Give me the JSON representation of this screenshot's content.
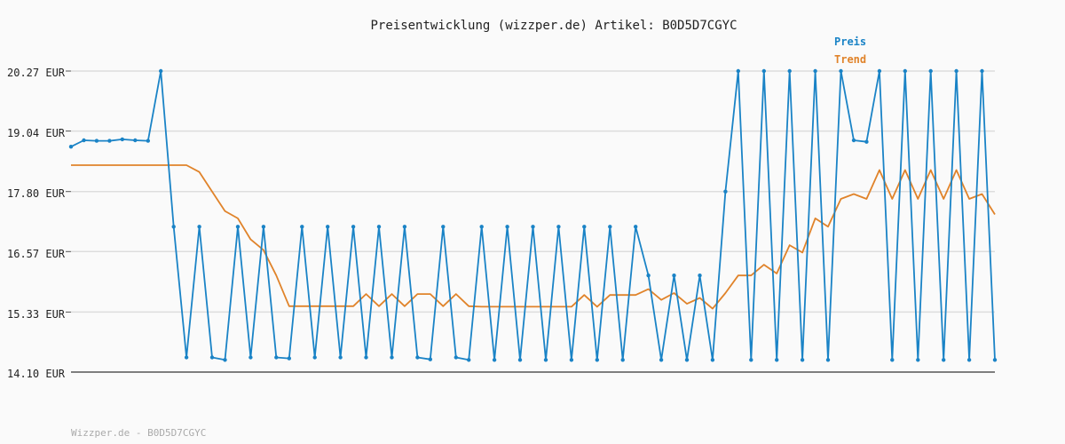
{
  "chart_data": {
    "type": "line",
    "title": "Preisentwicklung (wizzper.de) Artikel: B0D5D7CGYC",
    "footer": "Wizzper.de - B0D5D7CGYC",
    "ylim": [
      14.1,
      20.27
    ],
    "y_ticks": [
      "20.27 EUR",
      "19.04 EUR",
      "17.80 EUR",
      "16.57 EUR",
      "15.33 EUR",
      "14.10 EUR"
    ],
    "y_tick_values": [
      20.27,
      19.04,
      17.8,
      16.57,
      15.33,
      14.1
    ],
    "grid": true,
    "legend_position": "top-right",
    "colors": {
      "preis": "#1a83c6",
      "trend": "#e0832a",
      "grid": "#dddddd",
      "axis": "#555555"
    },
    "series": [
      {
        "name": "Preis",
        "values": [
          18.72,
          18.85,
          18.84,
          18.84,
          18.87,
          18.85,
          18.84,
          20.27,
          17.08,
          14.4,
          17.08,
          14.4,
          14.35,
          17.08,
          14.4,
          17.08,
          14.4,
          14.38,
          17.08,
          14.4,
          17.08,
          14.4,
          17.08,
          14.4,
          17.08,
          14.4,
          17.08,
          14.4,
          14.36,
          17.08,
          14.4,
          14.35,
          17.08,
          14.35,
          17.08,
          14.35,
          17.08,
          14.35,
          17.08,
          14.35,
          17.08,
          14.35,
          17.08,
          14.35,
          17.08,
          16.08,
          14.35,
          16.08,
          14.35,
          16.08,
          14.35,
          17.8,
          20.27,
          14.35,
          20.27,
          14.35,
          20.27,
          14.35,
          20.27,
          14.35,
          20.27,
          18.85,
          18.82,
          20.27,
          14.35,
          20.27,
          14.35,
          20.27,
          14.35,
          20.27,
          14.35,
          20.27,
          14.35
        ]
      },
      {
        "name": "Trend",
        "values": [
          18.34,
          18.34,
          18.34,
          18.34,
          18.34,
          18.34,
          18.34,
          18.34,
          18.34,
          18.34,
          18.2,
          17.8,
          17.4,
          17.25,
          16.82,
          16.6,
          16.08,
          15.45,
          15.45,
          15.45,
          15.45,
          15.45,
          15.45,
          15.7,
          15.45,
          15.7,
          15.45,
          15.7,
          15.7,
          15.45,
          15.7,
          15.45,
          15.44,
          15.44,
          15.44,
          15.44,
          15.44,
          15.44,
          15.44,
          15.44,
          15.68,
          15.44,
          15.68,
          15.68,
          15.68,
          15.8,
          15.58,
          15.72,
          15.5,
          15.62,
          15.4,
          15.72,
          16.08,
          16.08,
          16.3,
          16.12,
          16.7,
          16.55,
          17.25,
          17.08,
          17.65,
          17.75,
          17.65,
          18.24,
          17.65,
          18.24,
          17.65,
          18.24,
          17.65,
          18.24,
          17.65,
          17.75,
          17.33
        ]
      }
    ]
  }
}
